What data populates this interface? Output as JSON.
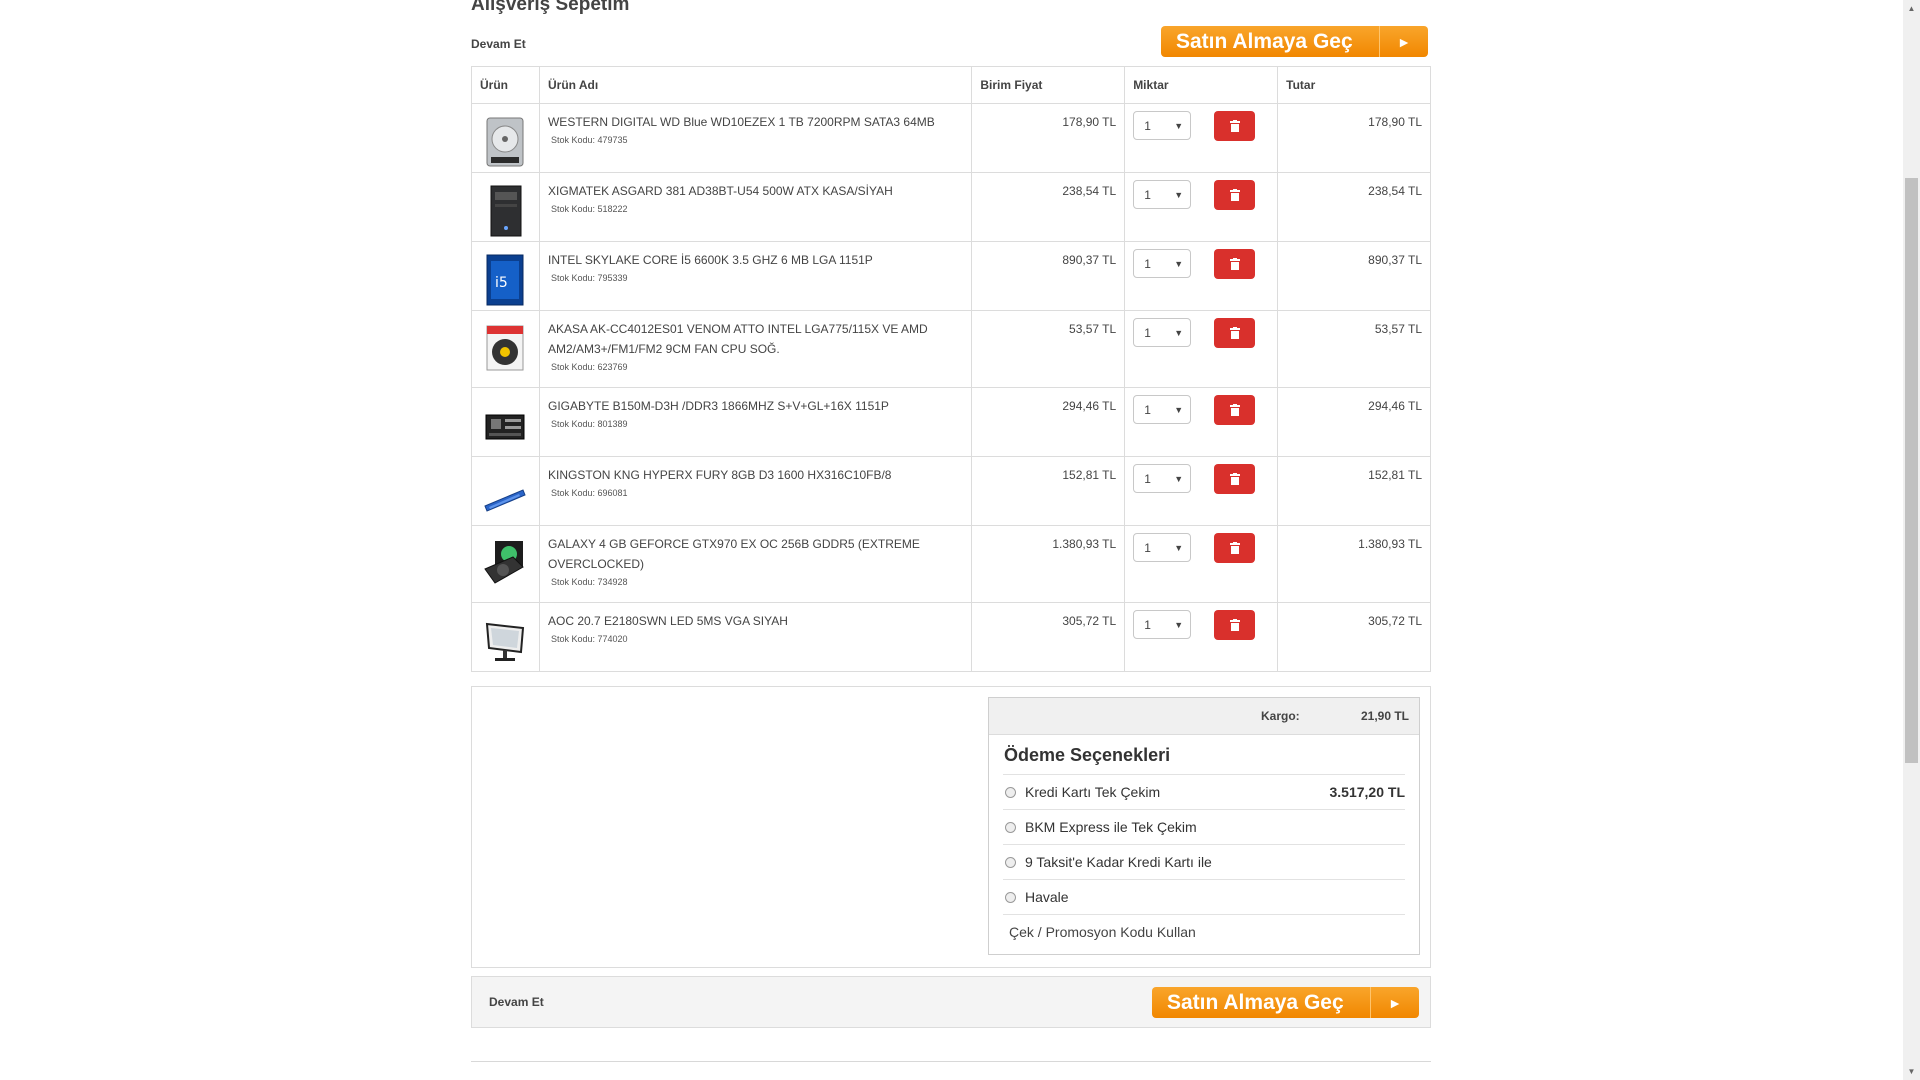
{
  "page": {
    "title": "Alışveriş Sepetim",
    "continue_label": "Devam Et",
    "checkout_label": "Satın Almaya Geç",
    "checkout_arrow": "►"
  },
  "table": {
    "headers": [
      "Ürün",
      "Ürün Adı",
      "Birim Fiyat",
      "Miktar",
      "Tutar"
    ],
    "stock_prefix": "Stok Kodu:",
    "items": [
      {
        "name": "WESTERN DIGITAL WD Blue WD10EZEX 1 TB 7200RPM SATA3 64MB",
        "stock": "Stok Kodu: 479735",
        "price": "178,90 TL",
        "qty": "1",
        "total": "178,90 TL",
        "icon": "hdd-icon"
      },
      {
        "name": "XIGMATEK ASGARD 381 AD38BT-U54 500W ATX KASA/SİYAH",
        "stock": "Stok Kodu: 518222",
        "price": "238,54 TL",
        "qty": "1",
        "total": "238,54 TL",
        "icon": "case-icon"
      },
      {
        "name": "INTEL SKYLAKE CORE İ5 6600K 3.5 GHZ 6 MB LGA 1151P",
        "stock": "Stok Kodu: 795339",
        "price": "890,37 TL",
        "qty": "1",
        "total": "890,37 TL",
        "icon": "cpu-box-icon"
      },
      {
        "name": "AKASA AK-CC4012ES01 VENOM ATTO INTEL LGA775/115X VE AMD AM2/AM3+/FM1/FM2 9CM FAN CPU SOĞ.",
        "stock": "Stok Kodu: 623769",
        "price": "53,57 TL",
        "qty": "1",
        "total": "53,57 TL",
        "icon": "fan-icon"
      },
      {
        "name": "GIGABYTE B150M-D3H /DDR3 1866MHZ S+V+GL+16X 1151P",
        "stock": "Stok Kodu: 801389",
        "price": "294,46 TL",
        "qty": "1",
        "total": "294,46 TL",
        "icon": "motherboard-icon"
      },
      {
        "name": "KINGSTON KNG HYPERX FURY 8GB D3 1600 HX316C10FB/8",
        "stock": "Stok Kodu: 696081",
        "price": "152,81 TL",
        "qty": "1",
        "total": "152,81 TL",
        "icon": "ram-icon"
      },
      {
        "name": "GALAXY 4 GB GEFORCE GTX970 EX OC 256B GDDR5 (EXTREME OVERCLOCKED)",
        "stock": "Stok Kodu: 734928",
        "price": "1.380,93 TL",
        "qty": "1",
        "total": "1.380,93 TL",
        "icon": "gpu-icon"
      },
      {
        "name": "AOC 20.7 E2180SWN LED 5MS VGA SIYAH",
        "stock": "Stok Kodu: 774020",
        "price": "305,72 TL",
        "qty": "1",
        "total": "305,72 TL",
        "icon": "monitor-icon"
      }
    ]
  },
  "summary": {
    "kargo_label": "Kargo:",
    "kargo_value": "21,90 TL",
    "payment_title": "Ödeme Seçenekleri",
    "options": [
      {
        "label": "Kredi Kartı Tek Çekim",
        "amount": "3.517,20 TL"
      },
      {
        "label": "BKM Express ile Tek Çekim",
        "amount": ""
      },
      {
        "label": "9 Taksit'e Kadar Kredi Kartı ile",
        "amount": ""
      },
      {
        "label": "Havale",
        "amount": ""
      }
    ],
    "promo_label": "Çek / Promosyon Kodu Kullan"
  },
  "colors": {
    "accent_orange": "#f18700",
    "delete_red": "#d9302c",
    "border": "#dcdcdc"
  }
}
